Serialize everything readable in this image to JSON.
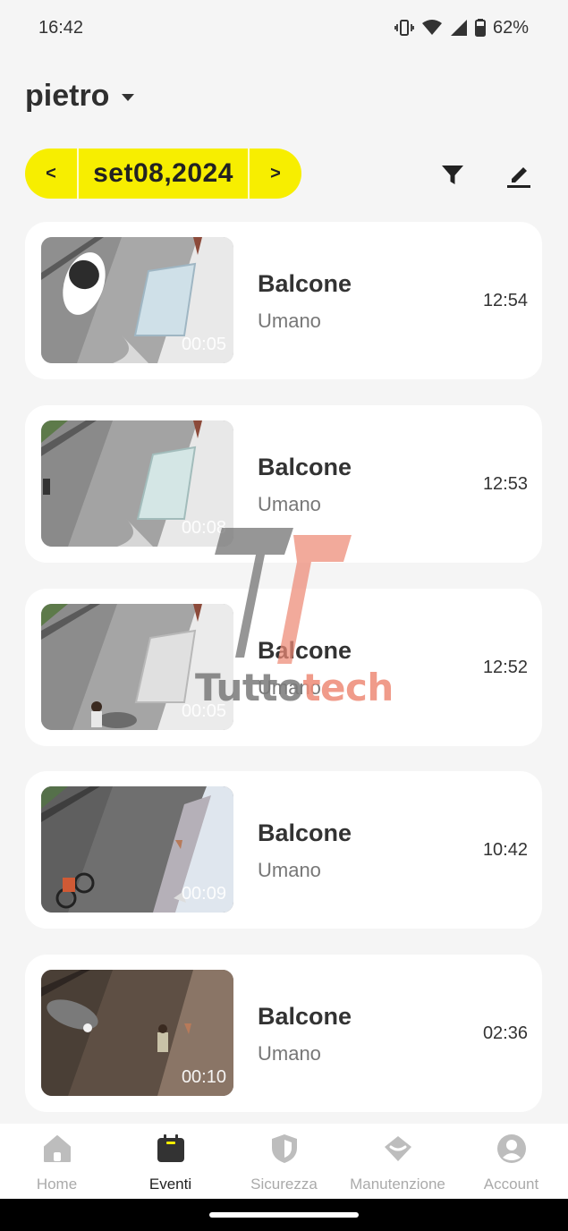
{
  "status_bar": {
    "time": "16:42",
    "battery": "62%"
  },
  "header": {
    "account_name": "pietro"
  },
  "date_selector": {
    "prev_label": "<",
    "date": "set08,2024",
    "next_label": ">"
  },
  "events": [
    {
      "title": "Balcone",
      "type": "Umano",
      "time": "12:54",
      "duration": "00:05"
    },
    {
      "title": "Balcone",
      "type": "Umano",
      "time": "12:53",
      "duration": "00:08"
    },
    {
      "title": "Balcone",
      "type": "Umano",
      "time": "12:52",
      "duration": "00:05"
    },
    {
      "title": "Balcone",
      "type": "Umano",
      "time": "10:42",
      "duration": "00:09"
    },
    {
      "title": "Balcone",
      "type": "Umano",
      "time": "02:36",
      "duration": "00:10"
    }
  ],
  "bottom_nav": [
    {
      "label": "Home",
      "icon": "home-icon"
    },
    {
      "label": "Eventi",
      "icon": "calendar-icon",
      "active": true
    },
    {
      "label": "Sicurezza",
      "icon": "shield-icon"
    },
    {
      "label": "Manutenzione",
      "icon": "maintenance-icon"
    },
    {
      "label": "Account",
      "icon": "account-icon"
    }
  ],
  "watermark": {
    "part1": "Tutto",
    "part2": "tech"
  },
  "colors": {
    "accent_yellow": "#f7ee00",
    "background": "#f5f5f5",
    "card": "#ffffff"
  }
}
